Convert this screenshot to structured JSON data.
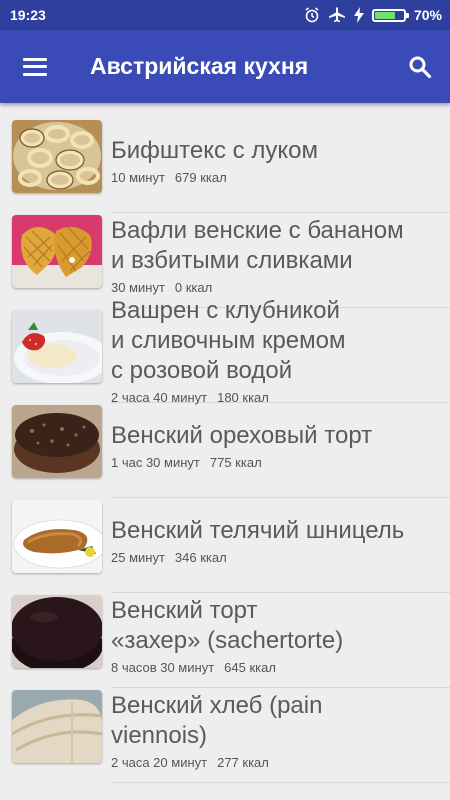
{
  "status": {
    "time": "19:23",
    "battery": "70%",
    "battery_level": 0.7
  },
  "toolbar": {
    "title": "Австрийская кухня"
  },
  "icons": {
    "menu": "hamburger-icon",
    "search": "search-icon",
    "alarm": "alarm-icon",
    "airplane": "airplane-icon",
    "charging": "charging-icon"
  },
  "items": [
    {
      "name": "Бифштекс с луком",
      "time": "10 минут",
      "kcal": "679 ккал"
    },
    {
      "name": "Вафли венские с бананом\nи взбитыми сливками",
      "time": "30 минут",
      "kcal": "0 ккал"
    },
    {
      "name": "Вашрен с клубникой\nи сливочным кремом\nс розовой водой",
      "time": "2 часа 40 минут",
      "kcal": "180 ккал"
    },
    {
      "name": "Венский ореховый торт",
      "time": "1 час 30 минут",
      "kcal": "775 ккал"
    },
    {
      "name": "Венский телячий шницель",
      "time": "25 минут",
      "kcal": "346 ккал"
    },
    {
      "name": "Венский торт\n«захер» (sachertorte)",
      "time": "8 часов 30 минут",
      "kcal": "645 ккал"
    },
    {
      "name": "Венский хлеб (pain\nviennois)",
      "time": "2 часа 20 минут",
      "kcal": "277 ккал"
    }
  ]
}
